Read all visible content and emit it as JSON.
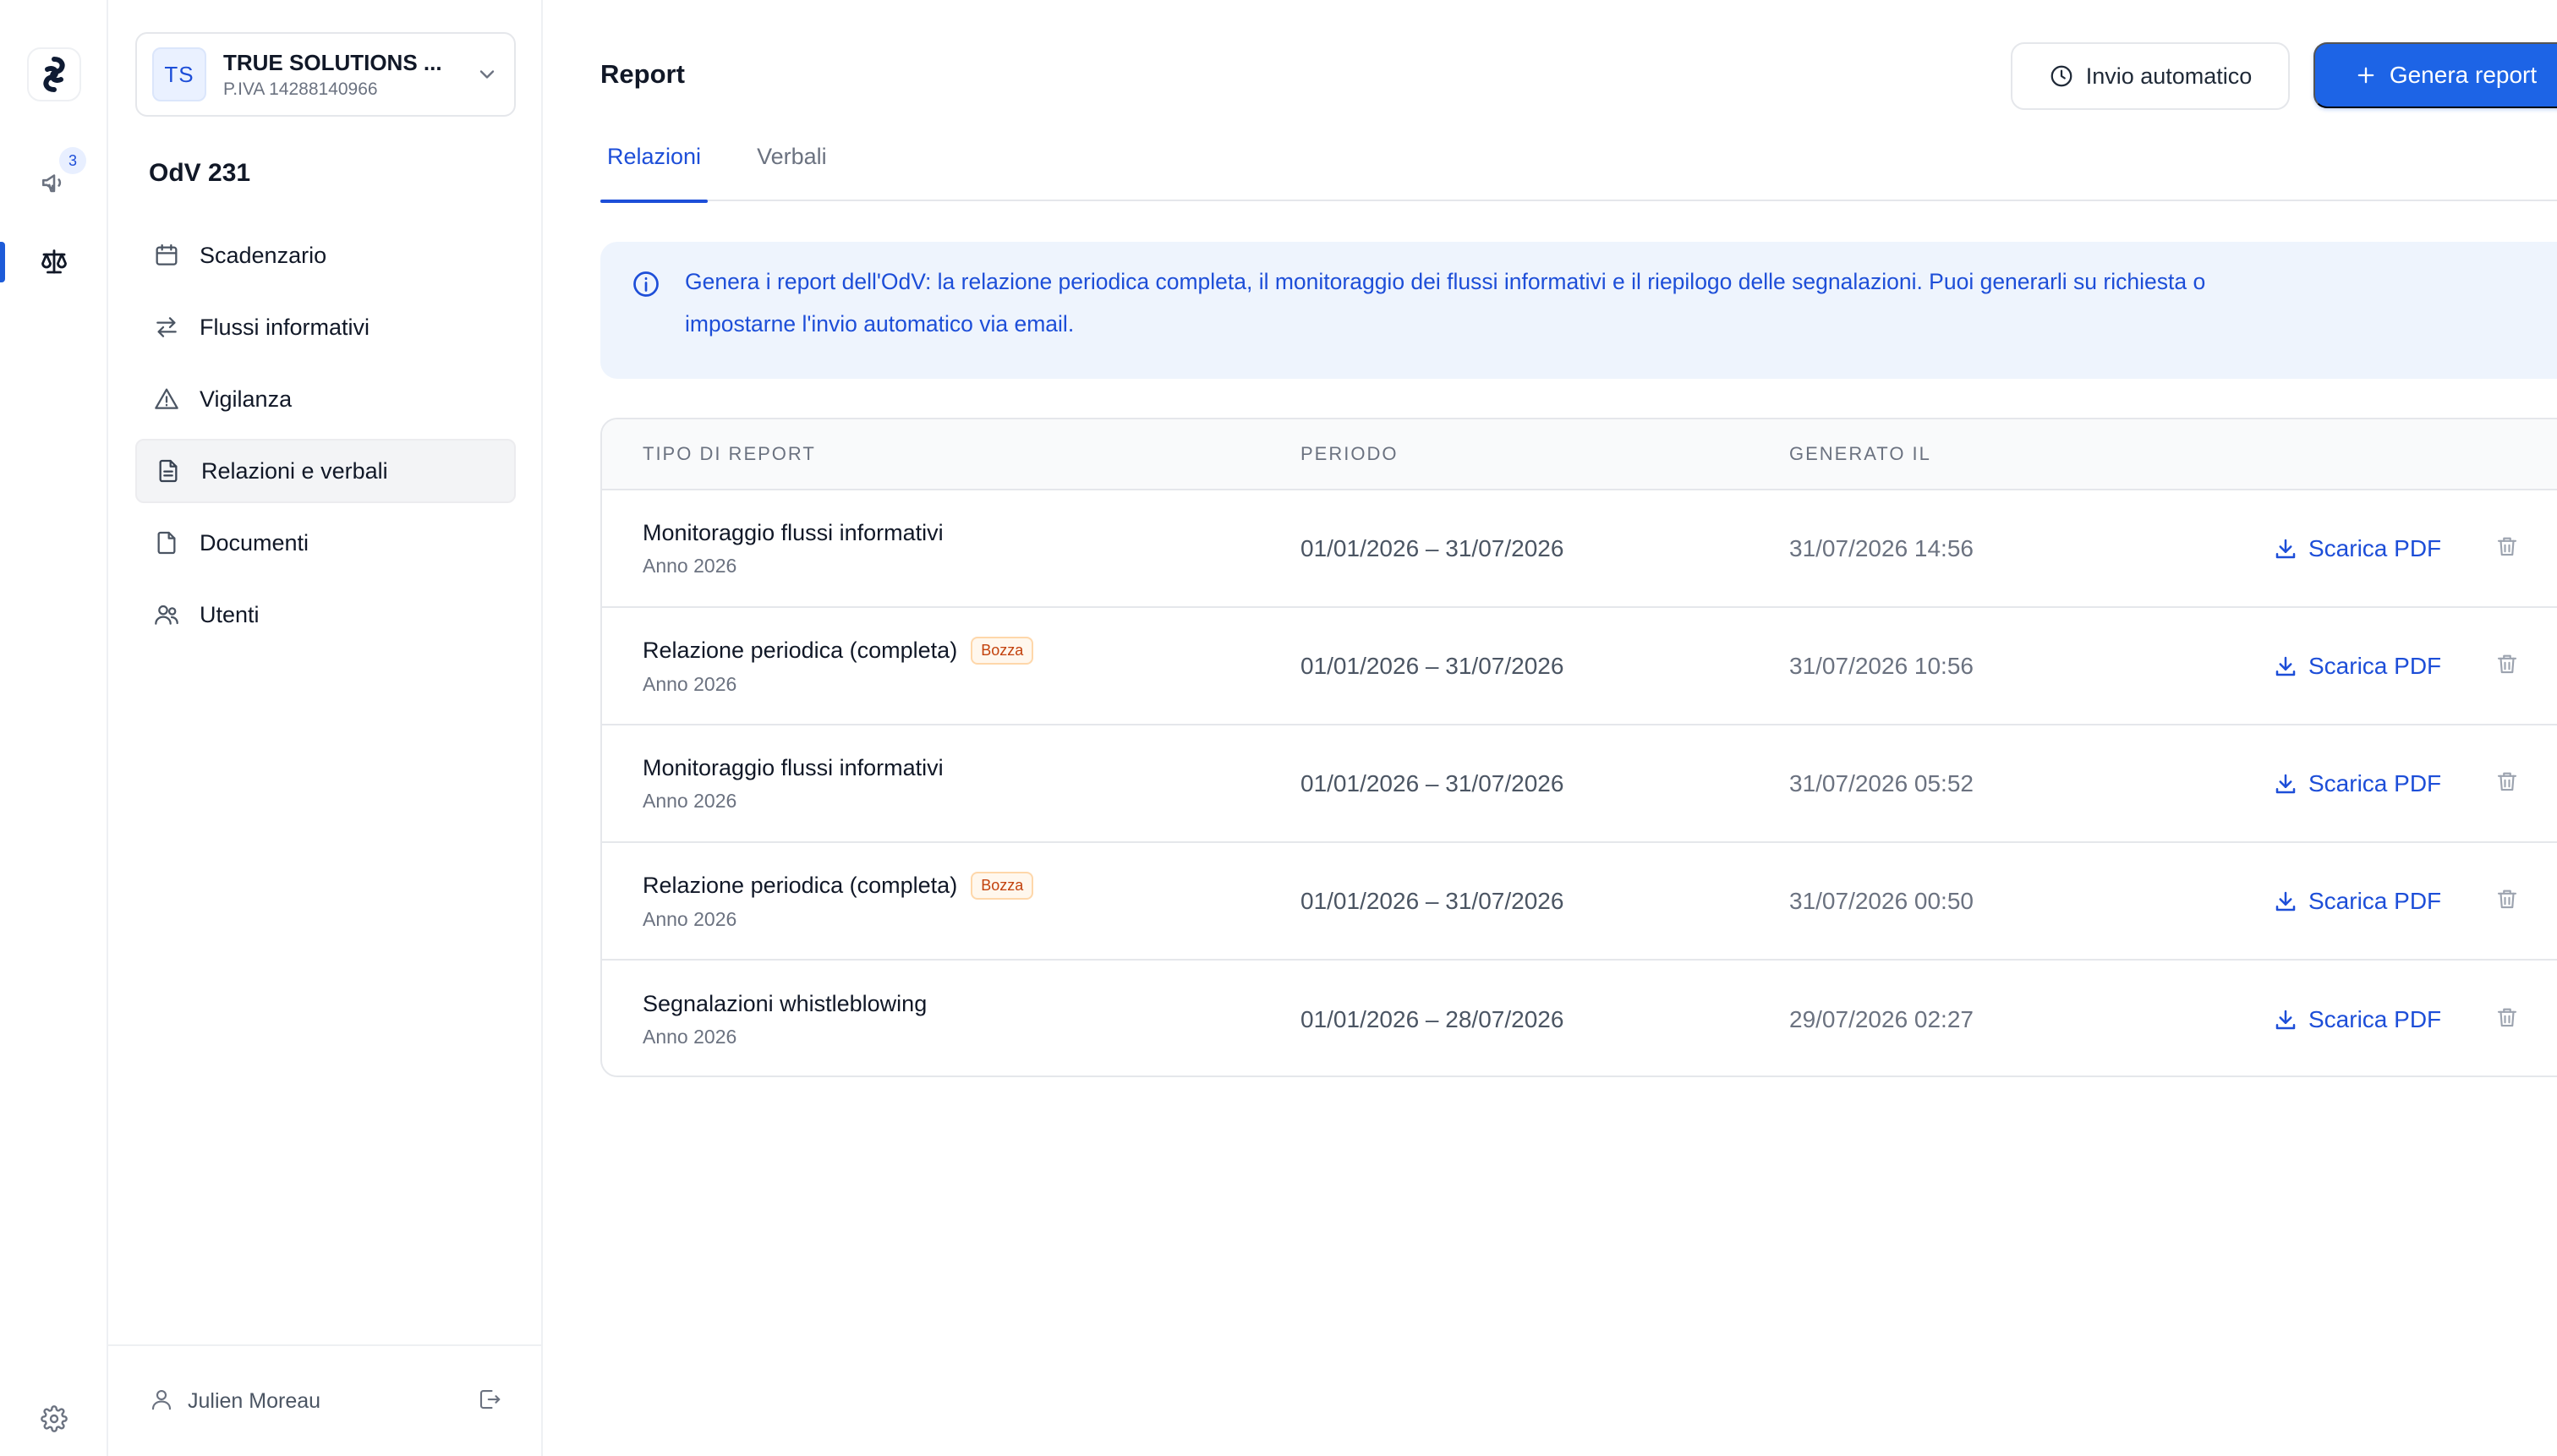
{
  "rail": {
    "badge_count": "3"
  },
  "org": {
    "initials": "TS",
    "name": "TRUE SOLUTIONS ...",
    "vat": "P.IVA 14288140966"
  },
  "sidebar": {
    "section_title": "OdV 231",
    "items": [
      {
        "label": "Scadenzario",
        "icon": "calendar-icon"
      },
      {
        "label": "Flussi informativi",
        "icon": "arrows-swap-icon"
      },
      {
        "label": "Vigilanza",
        "icon": "warning-icon"
      },
      {
        "label": "Relazioni e verbali",
        "icon": "document-icon",
        "active": true
      },
      {
        "label": "Documenti",
        "icon": "file-icon"
      },
      {
        "label": "Utenti",
        "icon": "users-icon"
      }
    ]
  },
  "user": {
    "name": "Julien Moreau"
  },
  "header": {
    "title": "Report",
    "auto_send_label": "Invio automatico",
    "generate_label": "Genera report"
  },
  "tabs": [
    {
      "label": "Relazioni",
      "active": true
    },
    {
      "label": "Verbali",
      "active": false
    }
  ],
  "info": {
    "text_line1": "Genera i report dell'OdV: la relazione periodica completa, il monitoraggio dei flussi informativi e il riepilogo delle segnalazioni. Puoi generarli su richiesta o",
    "text_line2": "impostarne l'invio automatico via email."
  },
  "table": {
    "headers": {
      "type": "TIPO DI REPORT",
      "period": "PERIODO",
      "generated": "GENERATO IL"
    },
    "download_label": "Scarica PDF",
    "rows": [
      {
        "title": "Monitoraggio flussi informativi",
        "subtitle": "Anno 2026",
        "badge": "",
        "period": "01/01/2026 – 31/07/2026",
        "generated": "31/07/2026 14:56"
      },
      {
        "title": "Relazione periodica (completa)",
        "subtitle": "Anno 2026",
        "badge": "Bozza",
        "period": "01/01/2026 – 31/07/2026",
        "generated": "31/07/2026 10:56"
      },
      {
        "title": "Monitoraggio flussi informativi",
        "subtitle": "Anno 2026",
        "badge": "",
        "period": "01/01/2026 – 31/07/2026",
        "generated": "31/07/2026 05:52"
      },
      {
        "title": "Relazione periodica (completa)",
        "subtitle": "Anno 2026",
        "badge": "Bozza",
        "period": "01/01/2026 – 31/07/2026",
        "generated": "31/07/2026 00:50"
      },
      {
        "title": "Segnalazioni whistleblowing",
        "subtitle": "Anno 2026",
        "badge": "",
        "period": "01/01/2026 – 28/07/2026",
        "generated": "29/07/2026 02:27"
      }
    ]
  },
  "colors": {
    "accent": "#1d64e6",
    "link": "#1d4ed8",
    "info_bg": "#eef4fd",
    "badge_text": "#c2410c",
    "badge_bg": "#fff7ed"
  }
}
